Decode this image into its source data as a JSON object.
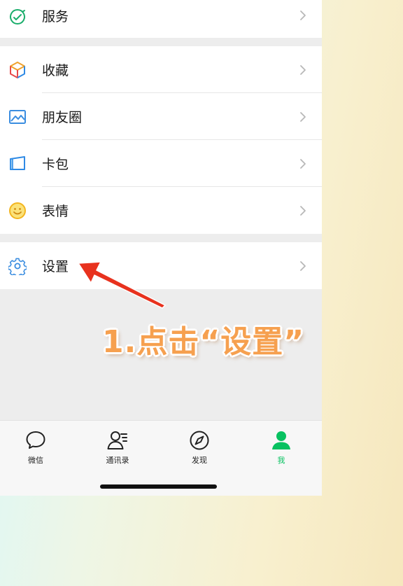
{
  "menu": {
    "service": {
      "label": "服务",
      "icon": "service-icon"
    },
    "favorites": {
      "label": "收藏",
      "icon": "favorites-cube-icon"
    },
    "moments": {
      "label": "朋友圈",
      "icon": "moments-picture-icon"
    },
    "cards": {
      "label": "卡包",
      "icon": "card-wallet-icon"
    },
    "stickers": {
      "label": "表情",
      "icon": "smiley-icon"
    },
    "settings": {
      "label": "设置",
      "icon": "gear-icon"
    }
  },
  "tabbar": {
    "chats": {
      "label": "微信",
      "icon": "chat-bubble-icon"
    },
    "contacts": {
      "label": "通讯录",
      "icon": "contacts-icon"
    },
    "discover": {
      "label": "发现",
      "icon": "compass-icon"
    },
    "me": {
      "label": "我",
      "icon": "person-icon",
      "active": true
    }
  },
  "annotation": {
    "text": "1.点击“设置”",
    "color": "#f6a04f"
  },
  "colors": {
    "accent_green": "#07c160",
    "arrow_red": "#e8321e"
  }
}
